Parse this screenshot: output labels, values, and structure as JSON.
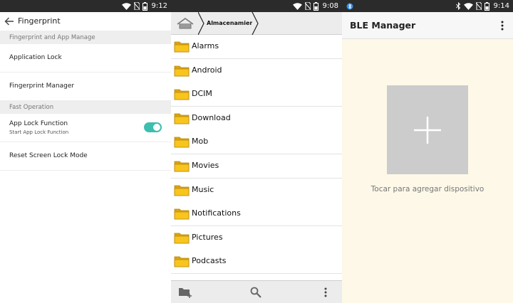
{
  "screens": [
    {
      "status": {
        "time": "9:12"
      },
      "header": {
        "title": "Fingerprint"
      },
      "sections": [
        {
          "title": "Fingerprint and App Manage",
          "items": [
            {
              "label": "Application Lock"
            },
            {
              "label": "Fingerprint Manager"
            }
          ]
        },
        {
          "title": "Fast Operation",
          "items": [
            {
              "label": "App Lock Function",
              "sublabel": "Start App Lock Function",
              "toggle_on": true
            },
            {
              "label": "Reset Screen Lock Mode"
            }
          ]
        }
      ],
      "colors": {
        "toggle": "#3cbfae"
      }
    },
    {
      "status": {
        "time": "9:08"
      },
      "breadcrumb": {
        "label": "Almacenamien"
      },
      "folders": [
        "Alarms",
        "Android",
        "DCIM",
        "Download",
        "Mob",
        "Movies",
        "Music",
        "Notifications",
        "Pictures",
        "Podcasts"
      ],
      "bottom_bar": {
        "icons": [
          "new-folder-icon",
          "search-icon",
          "more-vert-icon"
        ]
      },
      "colors": {
        "folder": "#f7c51e"
      }
    },
    {
      "status": {
        "time": "9:14"
      },
      "header": {
        "title": "BLE Manager"
      },
      "empty_state": {
        "hint": "Tocar para agregar dispositivo"
      },
      "colors": {
        "background": "#fdf8e8",
        "add_box": "#cccccc"
      }
    }
  ]
}
